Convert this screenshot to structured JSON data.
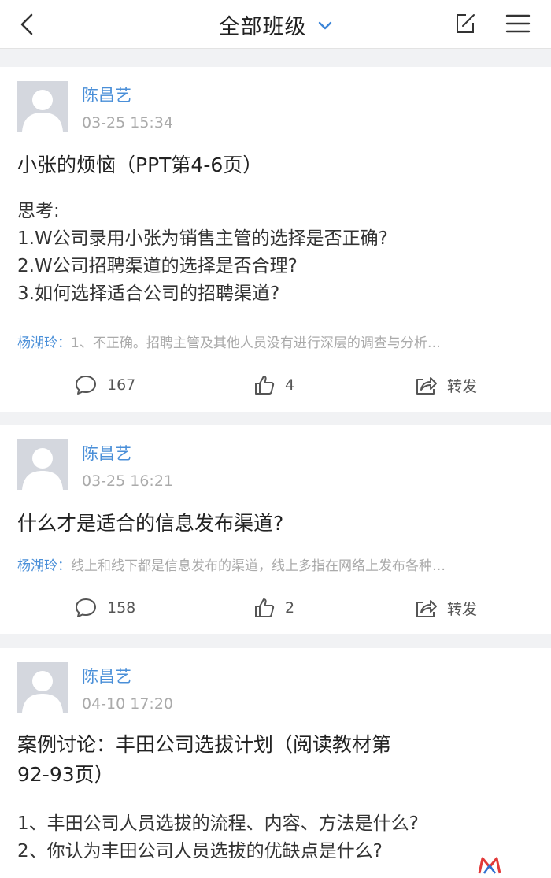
{
  "header": {
    "title": "全部班级",
    "icons": {
      "back": "back-arrow-icon",
      "dropdown": "chevron-down-icon",
      "edit": "edit-icon",
      "menu": "menu-icon"
    }
  },
  "posts": [
    {
      "author": "陈昌艺",
      "time": "03-25 15:34",
      "title": "小张的烦恼（PPT第4-6页）",
      "body": [
        "思考:",
        "1.W公司录用小张为销售主管的选择是否正确?",
        "2.W公司招聘渠道的选择是否合理?",
        "3.如何选择适合公司的招聘渠道?"
      ],
      "comment": {
        "name": "杨湖玲：",
        "text": "1、不正确。招聘主管及其他人员没有进行深层的调查与分析…"
      },
      "comments_count": "167",
      "likes": "4",
      "share_label": "转发"
    },
    {
      "author": "陈昌艺",
      "time": "03-25 16:21",
      "title": "什么才是适合的信息发布渠道?",
      "comment": {
        "name": "杨湖玲：",
        "text": "线上和线下都是信息发布的渠道，线上多指在网络上发布各种…"
      },
      "comments_count": "158",
      "likes": "2",
      "share_label": "转发"
    },
    {
      "author": "陈昌艺",
      "time": "04-10 17:20",
      "title_lines": [
        "案例讨论：丰田公司选拔计划（阅读教材第",
        "92-93页）"
      ],
      "body": [
        "1、丰田公司人员选拔的流程、内容、方法是什么?",
        "2、你认为丰田公司人员选拔的优缺点是什么?"
      ]
    }
  ],
  "colors": {
    "accent": "#4a8fd8",
    "muted": "#aaaaaa",
    "background": "#f1f2f4"
  }
}
